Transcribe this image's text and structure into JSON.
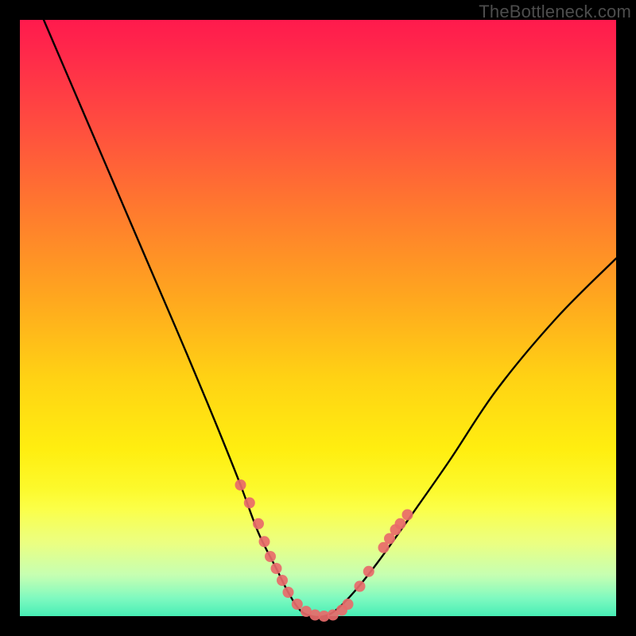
{
  "watermark": "TheBottleneck.com",
  "chart_data": {
    "type": "line",
    "title": "",
    "xlabel": "",
    "ylabel": "",
    "xlim": [
      0,
      100
    ],
    "ylim": [
      0,
      100
    ],
    "grid": false,
    "legend": false,
    "series": [
      {
        "name": "bottleneck-curve",
        "x": [
          4,
          10,
          16,
          22,
          28,
          33,
          37,
          40,
          43,
          45,
          47,
          49,
          51,
          53,
          56,
          60,
          65,
          72,
          80,
          90,
          100
        ],
        "y": [
          100,
          86,
          72,
          58,
          44,
          32,
          22,
          14,
          8,
          4,
          1,
          0,
          0,
          1,
          4,
          9,
          16,
          26,
          38,
          50,
          60
        ]
      }
    ],
    "markers": {
      "name": "highlight-points",
      "color": "#e86a6a",
      "radius": 7,
      "points": [
        {
          "x": 37.0,
          "y": 22.0
        },
        {
          "x": 38.5,
          "y": 19.0
        },
        {
          "x": 40.0,
          "y": 15.5
        },
        {
          "x": 41.0,
          "y": 12.5
        },
        {
          "x": 42.0,
          "y": 10.0
        },
        {
          "x": 43.0,
          "y": 8.0
        },
        {
          "x": 44.0,
          "y": 6.0
        },
        {
          "x": 45.0,
          "y": 4.0
        },
        {
          "x": 46.5,
          "y": 2.0
        },
        {
          "x": 48.0,
          "y": 0.8
        },
        {
          "x": 49.5,
          "y": 0.2
        },
        {
          "x": 51.0,
          "y": 0.0
        },
        {
          "x": 52.5,
          "y": 0.2
        },
        {
          "x": 54.0,
          "y": 1.0
        },
        {
          "x": 55.0,
          "y": 2.0
        },
        {
          "x": 57.0,
          "y": 5.0
        },
        {
          "x": 58.5,
          "y": 7.5
        },
        {
          "x": 61.0,
          "y": 11.5
        },
        {
          "x": 62.0,
          "y": 13.0
        },
        {
          "x": 63.0,
          "y": 14.5
        },
        {
          "x": 63.8,
          "y": 15.5
        },
        {
          "x": 65.0,
          "y": 17.0
        }
      ]
    },
    "background_gradient": {
      "top": "#ff1a4d",
      "mid": "#ffd214",
      "bottom": "#22e8a8"
    }
  }
}
